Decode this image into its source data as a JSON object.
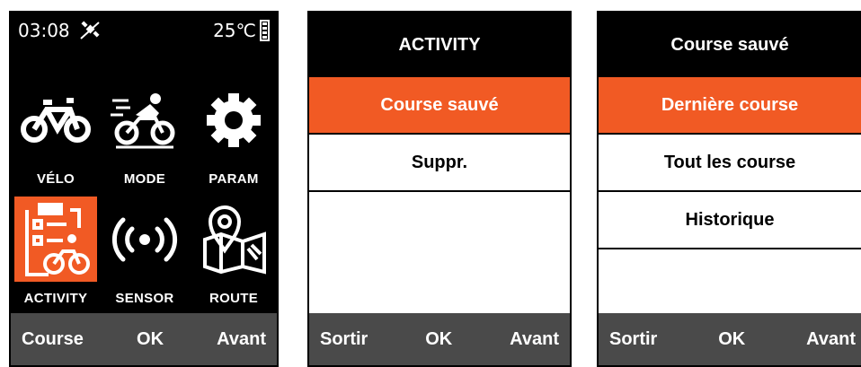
{
  "screen1": {
    "status": {
      "time": "03:08",
      "temperature": "25℃",
      "gps_icon": "gps-off-icon",
      "battery_icon": "battery-icon"
    },
    "tiles": [
      {
        "label": "VÉLO",
        "icon": "bicycle-icon"
      },
      {
        "label": "MODE",
        "icon": "cyclist-icon"
      },
      {
        "label": "PARAM",
        "icon": "gear-icon"
      },
      {
        "label": "ACTIVITY",
        "icon": "clipboard-cyclist-icon",
        "selected": true
      },
      {
        "label": "SENSOR",
        "icon": "sensor-signal-icon"
      },
      {
        "label": "ROUTE",
        "icon": "map-pin-icon"
      }
    ],
    "footer": {
      "left": "Course",
      "center": "OK",
      "right": "Avant"
    }
  },
  "screen2": {
    "title": "ACTIVITY",
    "items": [
      "Course sauvé",
      "Suppr."
    ],
    "selected_index": 0,
    "footer": {
      "left": "Sortir",
      "center": "OK",
      "right": "Avant"
    }
  },
  "screen3": {
    "title": "Course sauvé",
    "items": [
      "Dernière course",
      "Tout les course",
      "Historique"
    ],
    "selected_index": 0,
    "footer": {
      "left": "Sortir",
      "center": "OK",
      "right": "Avant"
    }
  },
  "colors": {
    "accent": "#f15a24",
    "footer_bg": "#4a4a4a",
    "dark_bg": "#000000"
  }
}
